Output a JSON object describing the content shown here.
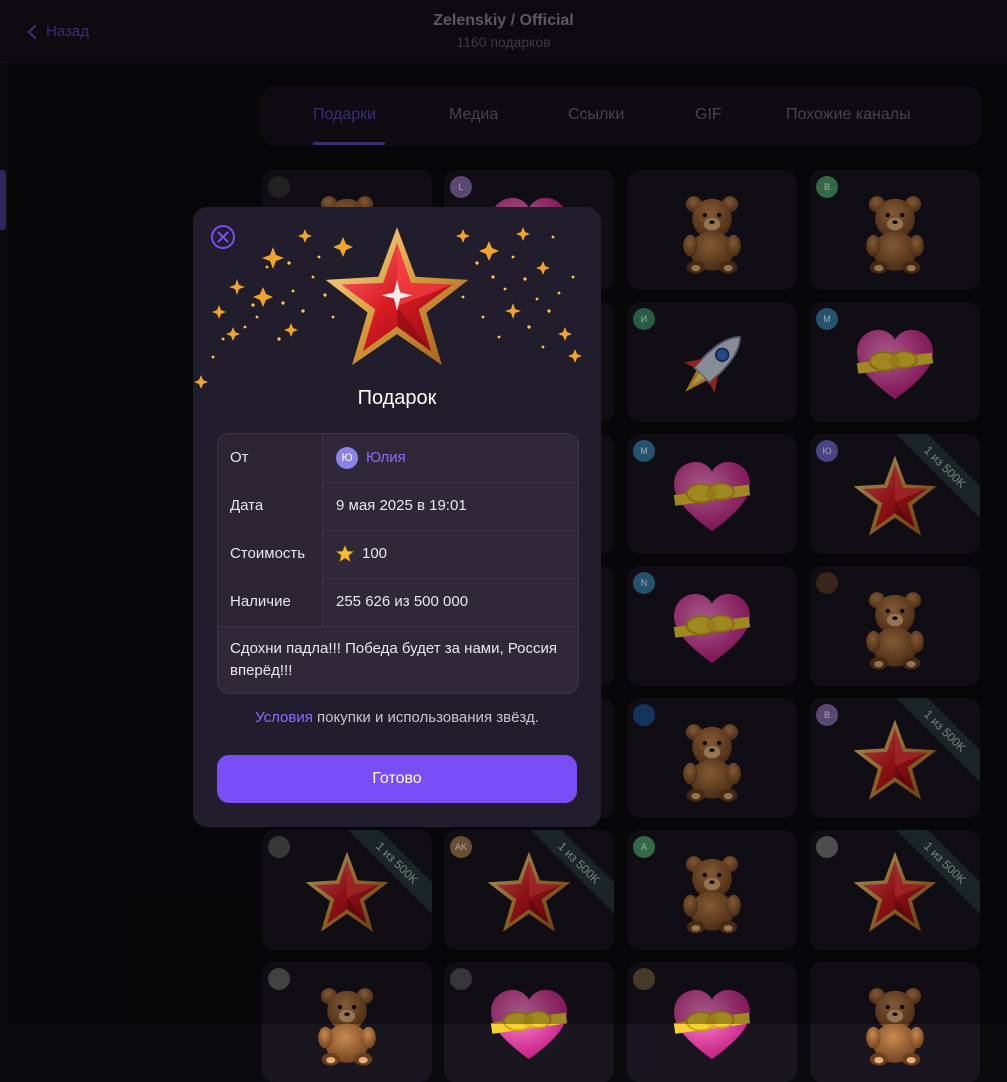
{
  "header": {
    "back_label": "Назад",
    "title": "Zelenskiy / Official",
    "subtitle": "1160 подарков"
  },
  "tabs": [
    "Подарки",
    "Медиа",
    "Ссылки",
    "GIF",
    "Похожие каналы"
  ],
  "active_tab": "Подарки",
  "badge_text": "1 из 500K",
  "grid_avatars": {
    "c01": "L",
    "c02": "B",
    "c11": "И",
    "c12": "M",
    "c20": "",
    "c21": "M",
    "c22": "Ю",
    "c32": "N",
    "c42": "B",
    "c51": "AK",
    "c52": "A"
  },
  "modal": {
    "title": "Подарок",
    "rows": {
      "from_label": "От",
      "from_avatar": "Ю",
      "from_value": "Юлия",
      "date_label": "Дата",
      "date_value": "9 мая 2025 в 19:01",
      "cost_label": "Стоимость",
      "cost_value": "100",
      "avail_label": "Наличие",
      "avail_value": "255 626 из 500 000"
    },
    "message": "Сдохни падла!!! Победа будет за нами, Россия вперёд!!!",
    "terms_link": "Условия",
    "terms_text": " покупки и использования звёзд.",
    "done_label": "Готово"
  },
  "colors": {
    "accent": "#7a4ef6",
    "link": "#8d6bff",
    "modal_bg": "#221d2c",
    "page_bg": "#0b0a0d"
  }
}
